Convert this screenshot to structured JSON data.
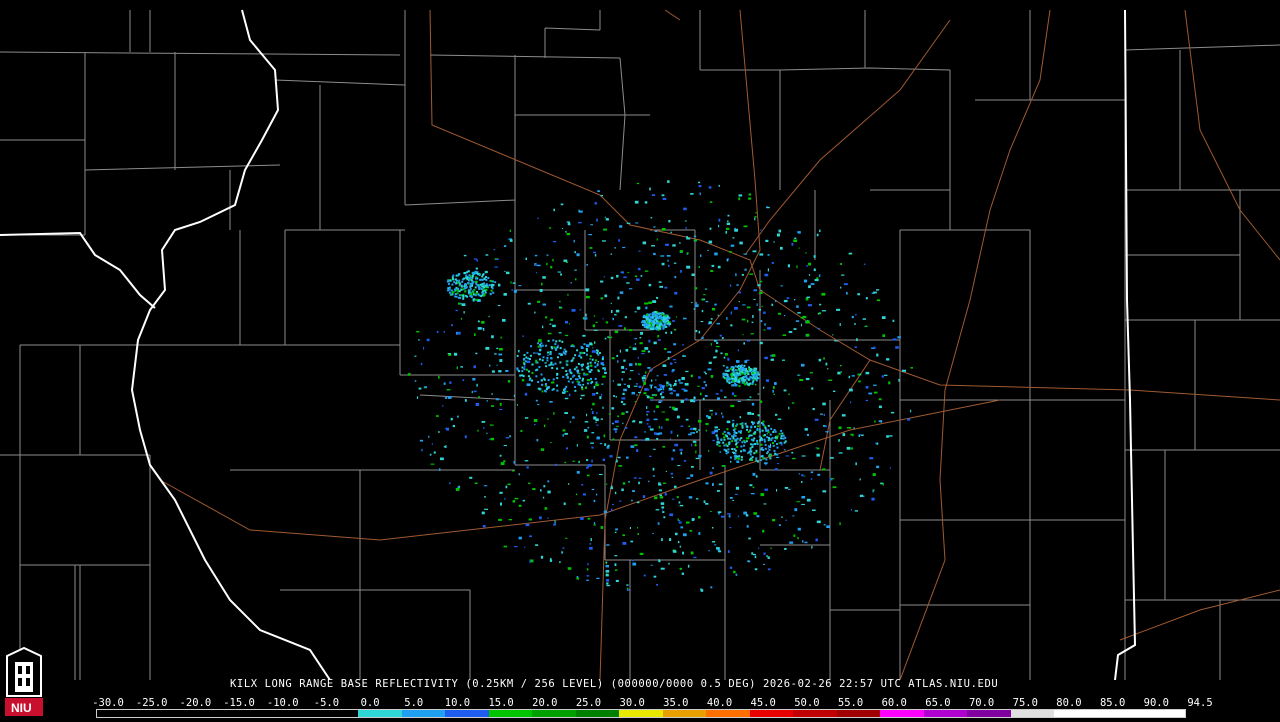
{
  "product": {
    "caption": "KILX LONG RANGE BASE REFLECTIVITY (0.25KM / 256 LEVEL) (000000/0000 0.5 DEG) 2026-02-26 22:57 UTC  ATLAS.NIU.EDU",
    "logo_text": "NIU",
    "logo_icon": "niu-tower-logo-icon"
  },
  "legend": {
    "labels": [
      "-30.0",
      "-25.0",
      "-20.0",
      "-15.0",
      "-10.0",
      "-5.0",
      "0.0",
      "5.0",
      "10.0",
      "15.0",
      "20.0",
      "25.0",
      "30.0",
      "35.0",
      "40.0",
      "45.0",
      "50.0",
      "55.0",
      "60.0",
      "65.0",
      "70.0",
      "75.0",
      "80.0",
      "85.0",
      "90.0",
      "94.5"
    ],
    "colors": [
      "#000000",
      "#000000",
      "#000000",
      "#000000",
      "#000000",
      "#000000",
      "#2fd6d6",
      "#1fa0f0",
      "#1f5cf0",
      "#00c400",
      "#00a000",
      "#008000",
      "#e8e800",
      "#e8a000",
      "#ff7000",
      "#e80000",
      "#c00000",
      "#a00000",
      "#ff00ff",
      "#b000d0",
      "#8000a0",
      "#e0e0e0",
      "#ffffff",
      "#ffffff",
      "#ffffff"
    ],
    "accent": {
      "county_lines": "#8c8c8c",
      "state_lines": "#ffffff",
      "highways": "#a05a32",
      "logo_red": "#c8102e"
    }
  }
}
